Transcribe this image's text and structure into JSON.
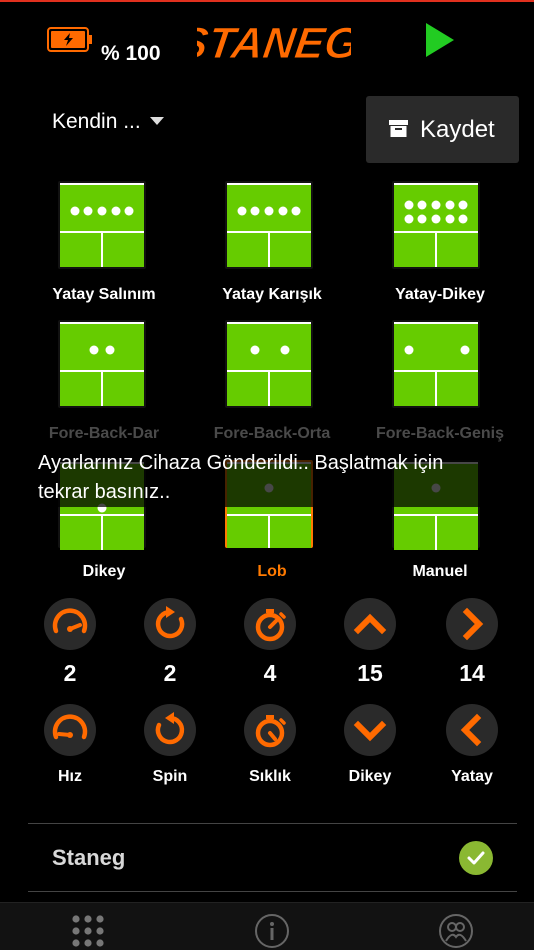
{
  "header": {
    "battery_label": "% 100",
    "logo_text": "STANEG"
  },
  "profile": {
    "selected": "Kendin ...",
    "save_label": "Kaydet"
  },
  "modes": [
    {
      "label": "Yatay Salınım",
      "state": "normal"
    },
    {
      "label": "Yatay Karışık",
      "state": "normal"
    },
    {
      "label": "Yatay-Dikey",
      "state": "normal"
    },
    {
      "label": "Fore-Back-Dar",
      "state": "faded"
    },
    {
      "label": "Fore-Back-Orta",
      "state": "faded"
    },
    {
      "label": "Fore-Back-Geniş",
      "state": "faded"
    },
    {
      "label": "Dikey",
      "state": "normal"
    },
    {
      "label": "Lob",
      "state": "selected"
    },
    {
      "label": "Manuel",
      "state": "normal"
    }
  ],
  "toast": {
    "message": "Ayarlarınız Cihaza Gönderildi.. Başlatmak için tekrar basınız.."
  },
  "settings": [
    {
      "label": "Hız",
      "value": "2",
      "up_icon": "speedometer-up-icon",
      "down_icon": "speedometer-down-icon"
    },
    {
      "label": "Spin",
      "value": "2",
      "up_icon": "rotate-cw-icon",
      "down_icon": "rotate-ccw-icon"
    },
    {
      "label": "Sıklık",
      "value": "4",
      "up_icon": "stopwatch-up-icon",
      "down_icon": "stopwatch-down-icon"
    },
    {
      "label": "Dikey",
      "value": "15",
      "up_icon": "chevron-up-icon",
      "down_icon": "chevron-down-icon"
    },
    {
      "label": "Yatay",
      "value": "14",
      "up_icon": "chevron-right-icon",
      "down_icon": "chevron-left-icon"
    }
  ],
  "device": {
    "name": "Staneg",
    "connected": true
  },
  "tabbar": {
    "items": [
      "grid-icon",
      "info-icon",
      "users-icon"
    ]
  },
  "colors": {
    "accent": "#ff7a00",
    "table_green": "#66cc00",
    "check_green": "#8ab832",
    "play_green": "#22cc22"
  }
}
